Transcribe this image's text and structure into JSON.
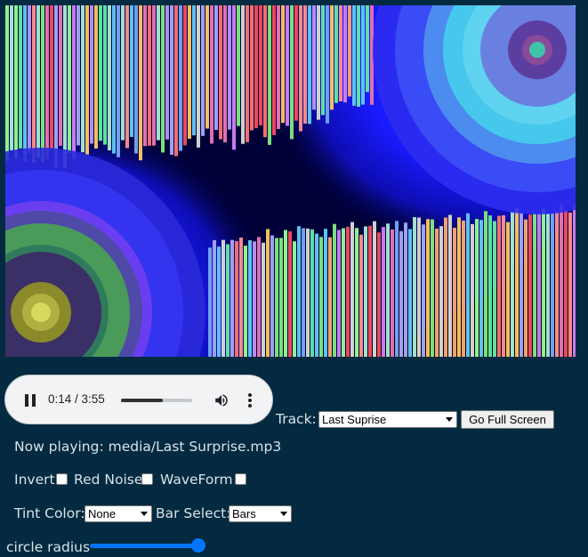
{
  "visualizer": {
    "background": "#000000"
  },
  "player": {
    "time": "0:14 / 3:55",
    "progress_fraction": 0.59,
    "play_state_icon": "pause-icon",
    "volume_icon": "volume-icon",
    "menu_icon": "more-vert-icon"
  },
  "controls": {
    "track_label": "Track:",
    "track_selected": "Last Suprise",
    "fullscreen_label": "Go Full Screen",
    "now_playing": "Now playing: media/Last Surprise.mp3",
    "invert_label": "Invert",
    "invert_checked": false,
    "red_noise_label": "Red Noise",
    "red_noise_checked": false,
    "waveform_label": "WaveForm",
    "waveform_checked": false,
    "tint_label": "Tint Color:",
    "tint_selected": "None",
    "bar_select_label": "Bar Select:",
    "bar_select_selected": "Bars",
    "circle_radius_label": "circle radius",
    "circle_radius_value": 1.0
  },
  "colors": {
    "page_bg": "#032a40",
    "accent": "#0075ff",
    "text": "#d7e3ea"
  }
}
